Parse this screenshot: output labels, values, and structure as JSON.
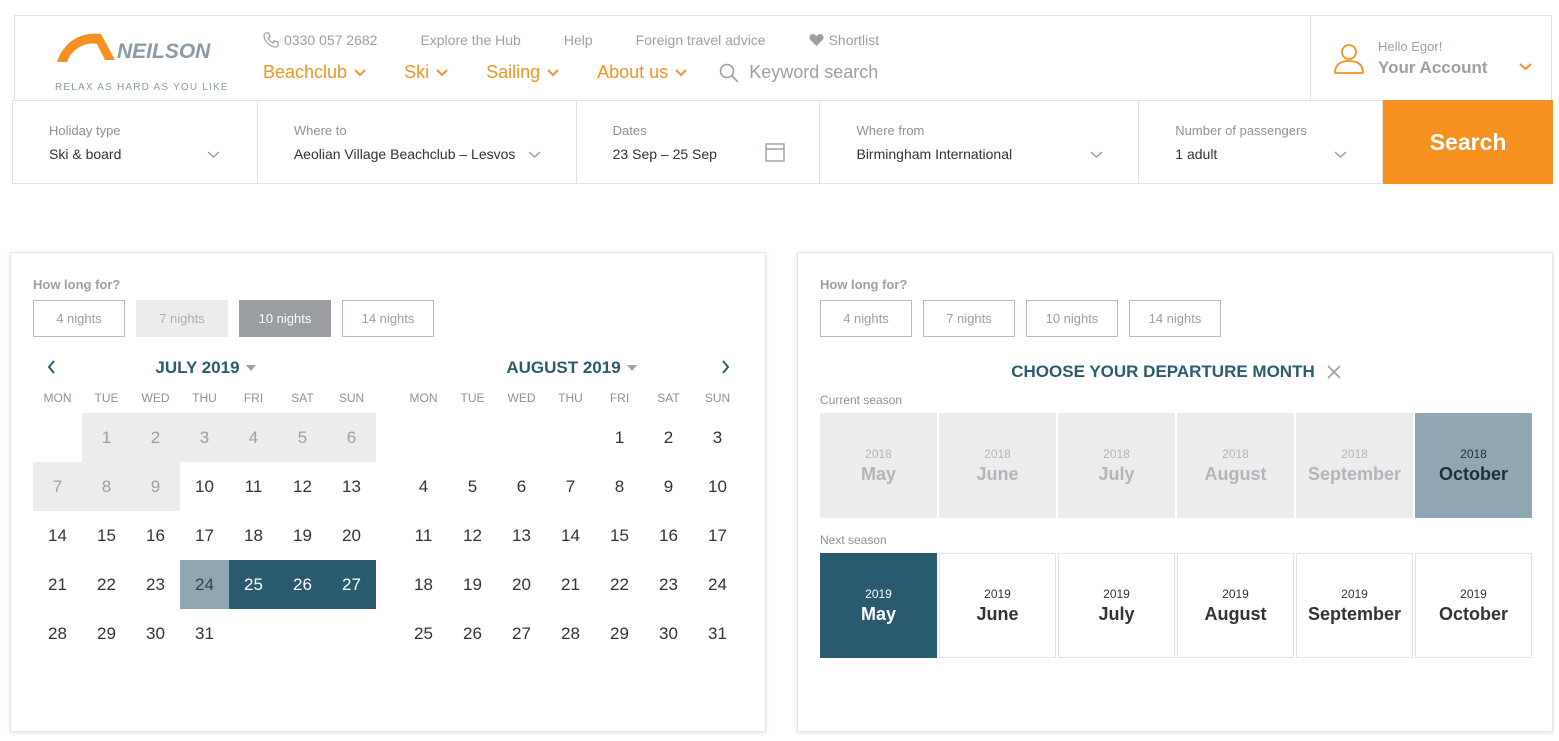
{
  "header": {
    "logo_text": "RELAX AS HARD AS YOU LIKE",
    "phone": "0330 057 2682",
    "top_links": [
      "Explore the Hub",
      "Help",
      "Foreign travel advice"
    ],
    "shortlist": "Shortlist",
    "nav": [
      "Beachclub",
      "Ski",
      "Sailing",
      "About us"
    ],
    "search_placeholder": "Keyword search",
    "greeting": "Hello Egor!",
    "account": "Your Account"
  },
  "search": {
    "holiday_type": {
      "label": "Holiday type",
      "value": "Ski & board"
    },
    "where_to": {
      "label": "Where to",
      "value": "Aeolian Village Beachclub – Lesvos"
    },
    "dates": {
      "label": "Dates",
      "value": "23 Sep – 25 Sep"
    },
    "where_from": {
      "label": "Where from",
      "value": "Birmingham International"
    },
    "passengers": {
      "label": "Number of passengers",
      "value": "1 adult"
    },
    "button": "Search"
  },
  "left_panel": {
    "how_long": "How long for?",
    "nights": [
      {
        "label": "4 nights",
        "state": "normal"
      },
      {
        "label": "7 nights",
        "state": "disabled"
      },
      {
        "label": "10 nights",
        "state": "active"
      },
      {
        "label": "14 nights",
        "state": "normal"
      }
    ],
    "weekdays": [
      "MON",
      "TUE",
      "WED",
      "THU",
      "FRI",
      "SAT",
      "SUN"
    ],
    "calendars": [
      {
        "title": "JULY 2019",
        "offset": 1,
        "days": 31,
        "past": [
          1,
          2,
          3,
          4,
          5,
          6,
          7,
          8,
          9
        ],
        "start": [
          24
        ],
        "selected": [
          25,
          26,
          27
        ]
      },
      {
        "title": "AUGUST 2019",
        "offset": 4,
        "days": 31,
        "past": [],
        "start": [],
        "selected": []
      }
    ]
  },
  "right_panel": {
    "how_long": "How long for?",
    "nights": [
      {
        "label": "4 nights",
        "state": "normal"
      },
      {
        "label": "7 nights",
        "state": "normal"
      },
      {
        "label": "10 nights",
        "state": "normal"
      },
      {
        "label": "14 nights",
        "state": "normal"
      }
    ],
    "title": "CHOOSE YOUR DEPARTURE MONTH",
    "current_label": "Current season",
    "next_label": "Next season",
    "current": [
      {
        "year": "2018",
        "month": "May",
        "active": false
      },
      {
        "year": "2018",
        "month": "June",
        "active": false
      },
      {
        "year": "2018",
        "month": "July",
        "active": false
      },
      {
        "year": "2018",
        "month": "August",
        "active": false
      },
      {
        "year": "2018",
        "month": "September",
        "active": false
      },
      {
        "year": "2018",
        "month": "October",
        "active": true
      }
    ],
    "next": [
      {
        "year": "2019",
        "month": "May",
        "active": true
      },
      {
        "year": "2019",
        "month": "June",
        "active": false
      },
      {
        "year": "2019",
        "month": "July",
        "active": false
      },
      {
        "year": "2019",
        "month": "August",
        "active": false
      },
      {
        "year": "2019",
        "month": "September",
        "active": false
      },
      {
        "year": "2019",
        "month": "October",
        "active": false
      }
    ]
  },
  "colors": {
    "brand_orange": "#f6901e",
    "teal": "#2a5a6f",
    "slate": "#8fa7b3"
  }
}
